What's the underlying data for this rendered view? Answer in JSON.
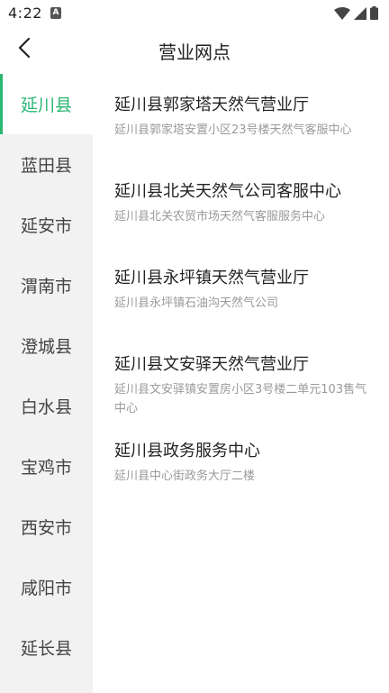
{
  "status": {
    "time": "4:22",
    "notif_icon": "a-notification-icon"
  },
  "header": {
    "title": "营业网点"
  },
  "sidebar": {
    "items": [
      {
        "label": "延川县",
        "active": true
      },
      {
        "label": "蓝田县",
        "active": false
      },
      {
        "label": "延安市",
        "active": false
      },
      {
        "label": "渭南市",
        "active": false
      },
      {
        "label": "澄城县",
        "active": false
      },
      {
        "label": "白水县",
        "active": false
      },
      {
        "label": "宝鸡市",
        "active": false
      },
      {
        "label": "西安市",
        "active": false
      },
      {
        "label": "咸阳市",
        "active": false
      },
      {
        "label": "延长县",
        "active": false
      }
    ]
  },
  "outlets": [
    {
      "name": "延川县郭家塔天然气营业厅",
      "address": "延川县郭家塔安置小区23号楼天然气客服中心"
    },
    {
      "name": "延川县北关天然气公司客服中心",
      "address": "延川县北关农贸市场天然气客服服务中心"
    },
    {
      "name": "延川县永坪镇天然气营业厅",
      "address": "延川县永坪镇石油沟天然气公司"
    },
    {
      "name": "延川县文安驿天然气营业厅",
      "address": "延川县文安驿镇安置房小区3号楼二单元103售气中心"
    },
    {
      "name": "延川县政务服务中心",
      "address": "延川县中心街政务大厅二楼"
    }
  ],
  "colors": {
    "accent": "#2bb673",
    "sidebar_bg": "#f2f2f3"
  }
}
